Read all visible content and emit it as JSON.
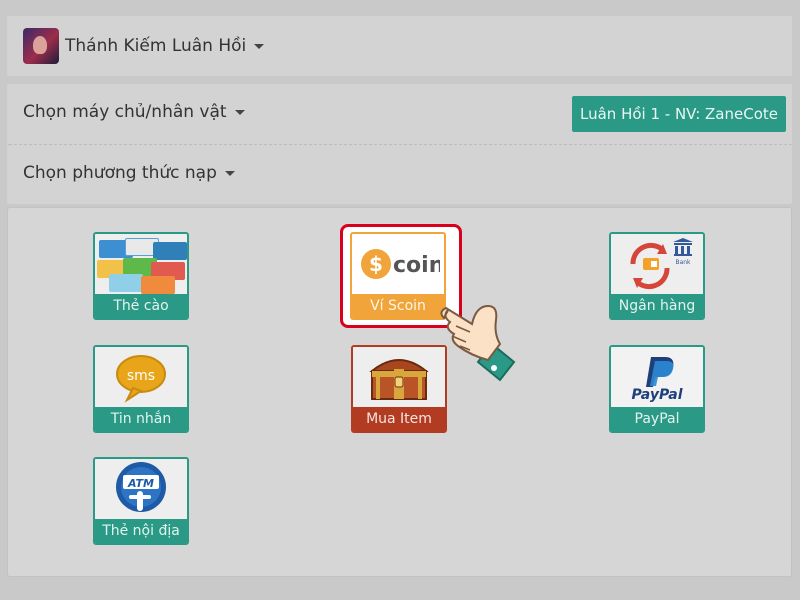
{
  "game": {
    "title": "Thánh Kiếm Luân Hồi"
  },
  "server": {
    "label": "Chọn máy chủ/nhân vật",
    "selected": "Luân Hồi 1 - NV: ZaneCote"
  },
  "payment": {
    "label": "Chọn phương thức nạp",
    "methods": [
      {
        "label": "Thẻ cào",
        "icon": "scratch-card-icon"
      },
      {
        "label": "Ví Scoin",
        "icon": "scoin-icon"
      },
      {
        "label": "Ngân hàng",
        "icon": "bank-icon"
      },
      {
        "label": "Tin nhắn",
        "icon": "sms-icon"
      },
      {
        "label": "Mua Item",
        "icon": "treasure-chest-icon"
      },
      {
        "label": "PayPal",
        "icon": "paypal-icon"
      },
      {
        "label": "Thẻ nội địa",
        "icon": "atm-card-icon"
      }
    ]
  },
  "logos": {
    "scoin_text": "coin",
    "paypal_text": "PayPal",
    "sms_text": "sms",
    "atm_text": "ATM",
    "bank_text": "Bank"
  },
  "colors": {
    "accent": "#2a9a86",
    "scoin": "#f0a43a",
    "item": "#b23c22",
    "highlight": "#d9001b"
  }
}
